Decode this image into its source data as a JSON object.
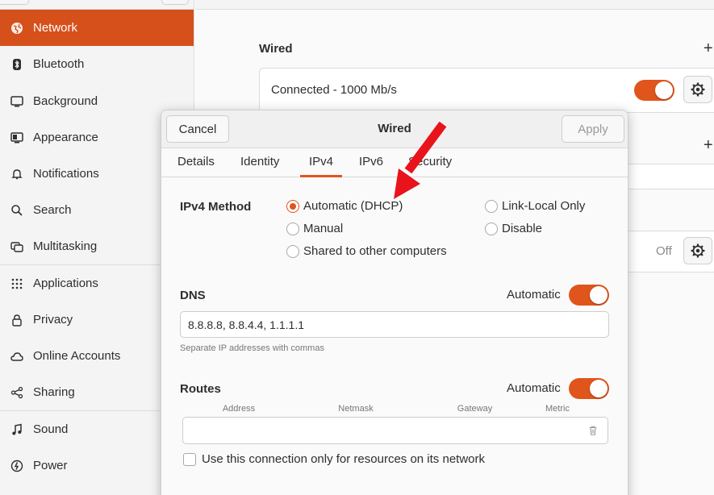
{
  "sidebar": {
    "items": [
      {
        "label": "Network",
        "icon": "network-icon",
        "active": true
      },
      {
        "label": "Bluetooth",
        "icon": "bluetooth-icon"
      },
      {
        "label": "Background",
        "icon": "background-icon"
      },
      {
        "label": "Appearance",
        "icon": "appearance-icon"
      },
      {
        "label": "Notifications",
        "icon": "bell-icon"
      },
      {
        "label": "Search",
        "icon": "search-icon"
      },
      {
        "label": "Multitasking",
        "icon": "multitasking-icon"
      },
      {
        "label": "Applications",
        "icon": "grid-icon"
      },
      {
        "label": "Privacy",
        "icon": "lock-icon"
      },
      {
        "label": "Online Accounts",
        "icon": "cloud-icon"
      },
      {
        "label": "Sharing",
        "icon": "share-icon"
      },
      {
        "label": "Sound",
        "icon": "music-note-icon"
      },
      {
        "label": "Power",
        "icon": "power-icon"
      }
    ]
  },
  "main": {
    "wired_heading": "Wired",
    "connection_status": "Connected - 1000 Mb/s",
    "connection_on": true,
    "second_status": "Off"
  },
  "dialog": {
    "title": "Wired",
    "cancel_label": "Cancel",
    "apply_label": "Apply",
    "tabs": [
      "Details",
      "Identity",
      "IPv4",
      "IPv6",
      "Security"
    ],
    "active_tab": "IPv4",
    "method_label": "IPv4 Method",
    "methods": {
      "automatic": "Automatic (DHCP)",
      "manual": "Manual",
      "shared": "Shared to other computers",
      "link_local": "Link-Local Only",
      "disable": "Disable"
    },
    "selected_method": "automatic",
    "dns": {
      "label": "DNS",
      "auto_label": "Automatic",
      "auto_on": true,
      "value": "8.8.8.8, 8.8.4.4, 1.1.1.1",
      "hint": "Separate IP addresses with commas"
    },
    "routes": {
      "label": "Routes",
      "auto_label": "Automatic",
      "auto_on": true,
      "columns": [
        "Address",
        "Netmask",
        "Gateway",
        "Metric"
      ]
    },
    "only_resources_label": "Use this connection only for resources on its network",
    "only_resources_checked": false
  },
  "colors": {
    "accent": "#e0551b",
    "sidebar_active": "#d6501c",
    "annotation_arrow": "#e8131b"
  }
}
